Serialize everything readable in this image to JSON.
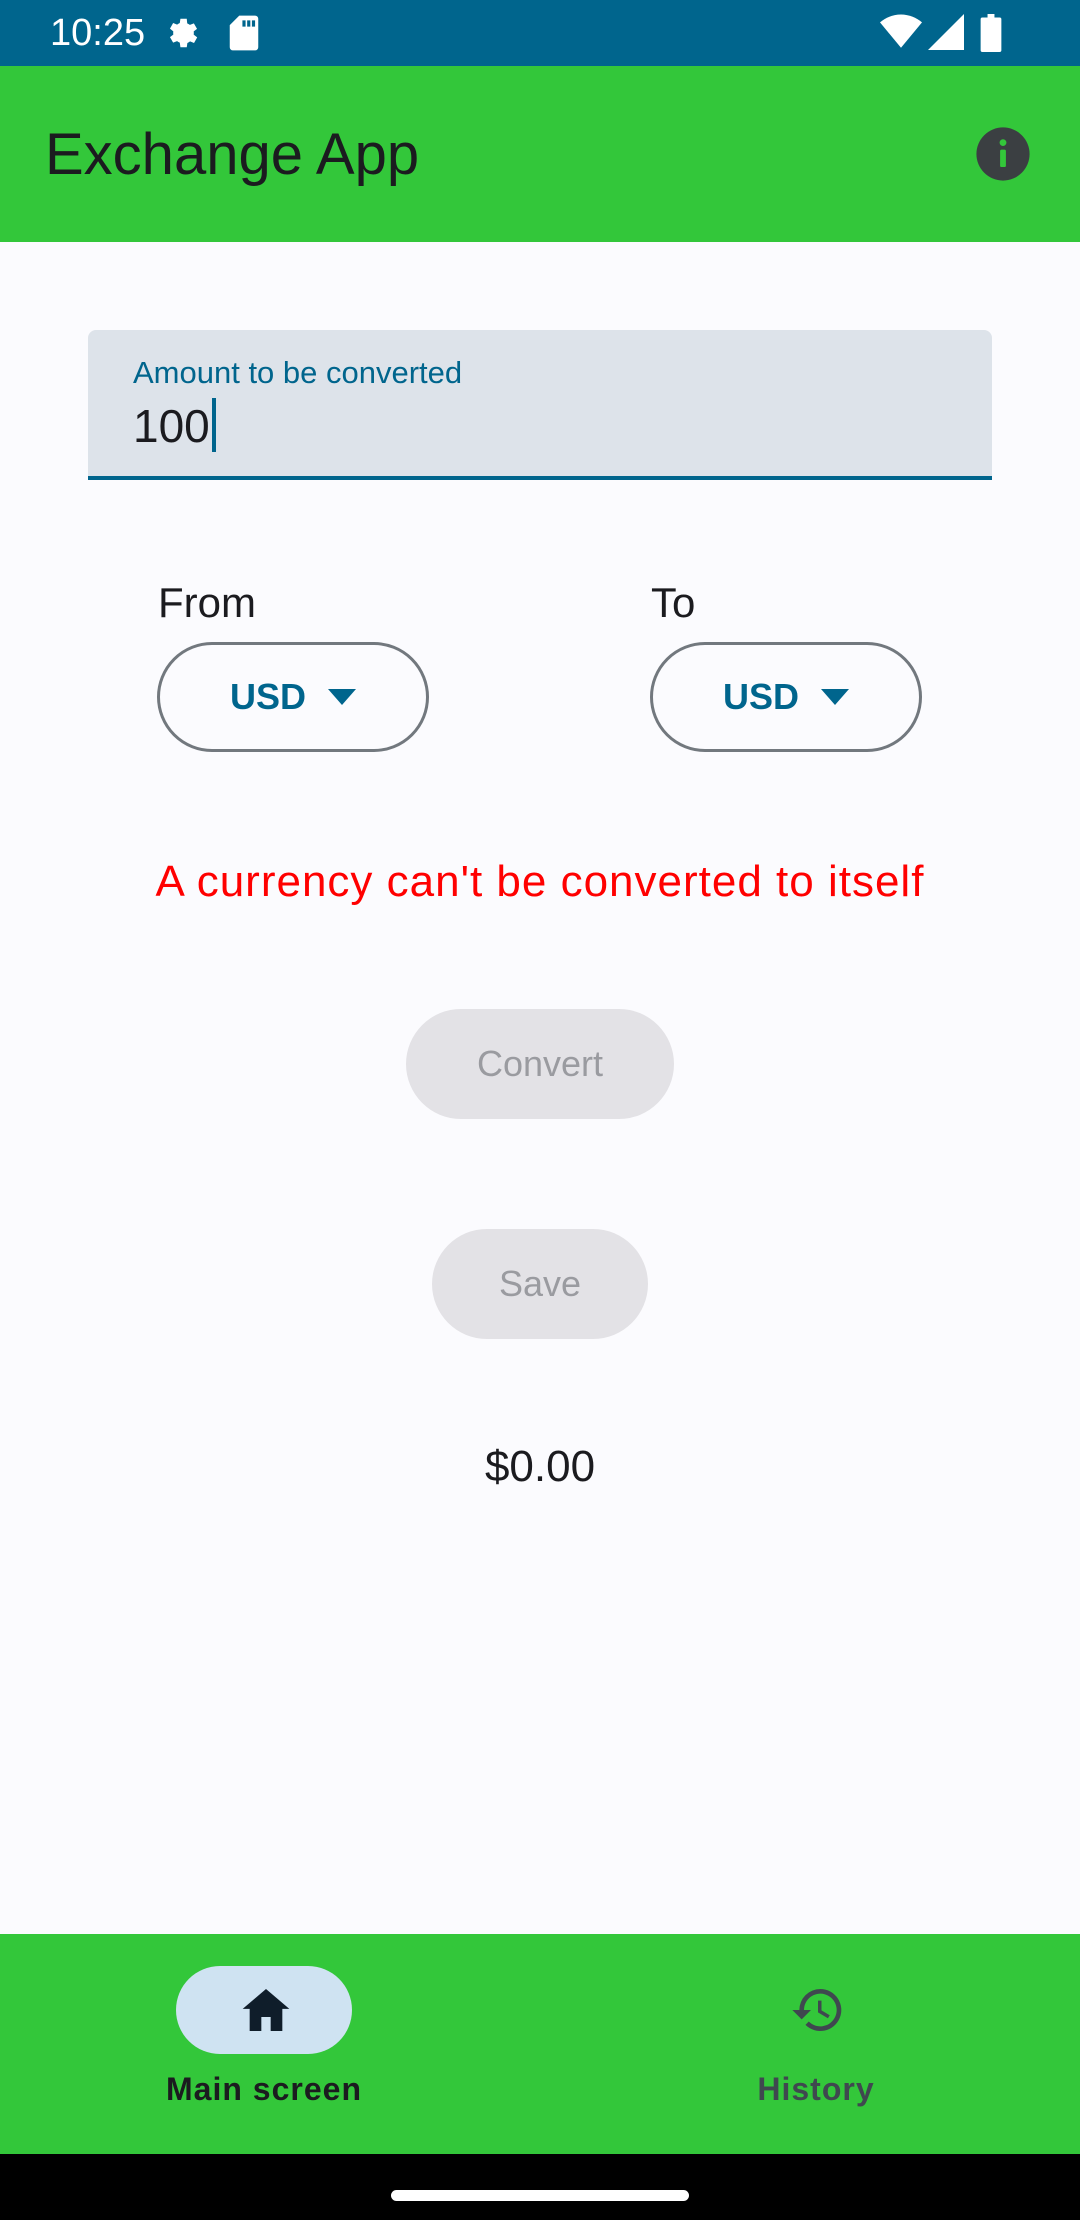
{
  "status_bar": {
    "time": "10:25",
    "icons": [
      "settings-gear-icon",
      "sd-card-icon",
      "wifi-icon",
      "cell-signal-icon",
      "battery-icon"
    ]
  },
  "app_bar": {
    "title": "Exchange App",
    "info_icon": "info-icon"
  },
  "amount_field": {
    "label": "Amount to be converted",
    "value": "100"
  },
  "from": {
    "label": "From",
    "selected": "USD"
  },
  "to": {
    "label": "To",
    "selected": "USD"
  },
  "error_message": "A currency can't be converted to itself",
  "buttons": {
    "convert_label": "Convert",
    "save_label": "Save",
    "convert_enabled": false,
    "save_enabled": false
  },
  "result": "$0.00",
  "bottom_nav": {
    "items": [
      {
        "label": "Main screen",
        "icon": "home-icon",
        "selected": true
      },
      {
        "label": "History",
        "icon": "history-icon",
        "selected": false
      }
    ]
  },
  "colors": {
    "status_bar": "#00658d",
    "app_bar": "#33c73a",
    "primary": "#00658d",
    "error": "#ff0000",
    "nav_indicator": "#cfe3f2",
    "disabled_button": "#e3e2e6"
  }
}
